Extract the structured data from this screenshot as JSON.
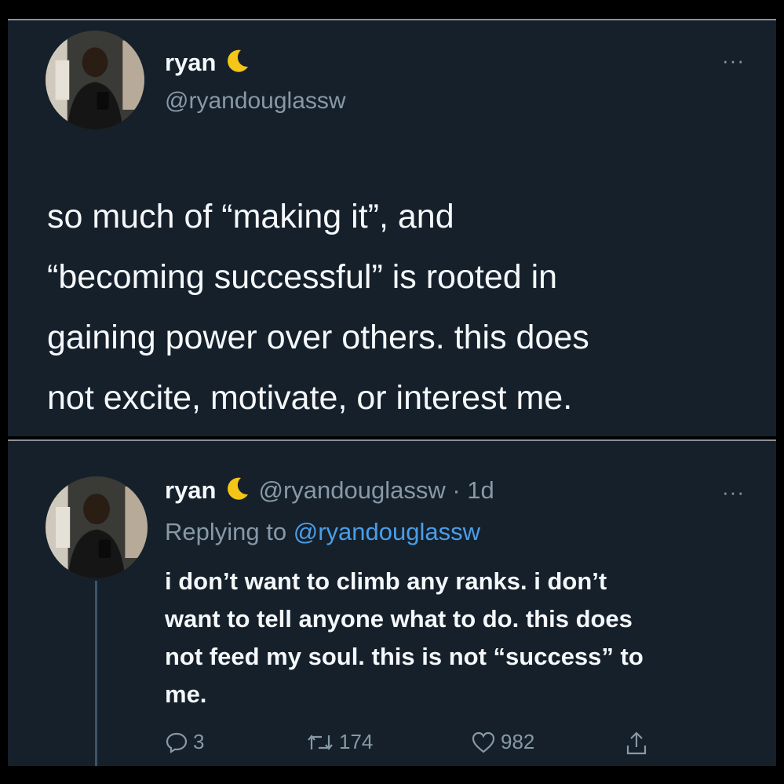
{
  "tweet": {
    "author_name": "ryan",
    "author_handle": "@ryandouglassw",
    "text_lines": [
      "so much of “making it”, and",
      "“becoming successful” is rooted in",
      "gaining power over others. this does",
      "not excite, motivate, or interest me."
    ],
    "more_label": "···"
  },
  "reply": {
    "author_name": "ryan",
    "handle_time": "@ryandouglassw · 1d",
    "replying_prefix": "Replying to",
    "replying_mention": "@ryandouglassw",
    "text_lines": [
      "i don’t want to climb any ranks. i don’t",
      "want to tell anyone what to do. this does",
      "not feed my soul. this is not “success” to",
      "me."
    ],
    "more_label": "···",
    "reply_count": "3",
    "retweet_count": "174",
    "like_count": "982"
  },
  "icons": {
    "moon": "crescent-moon-icon",
    "more": "more-dots-icon",
    "reply": "reply-bubble-icon",
    "retweet": "retweet-icon",
    "like": "heart-icon",
    "share": "share-icon"
  },
  "colors": {
    "background": "#15202b",
    "text": "#f5f8fa",
    "secondary": "#8899a6",
    "link": "#4a9ee8",
    "moon": "#f5c518"
  }
}
